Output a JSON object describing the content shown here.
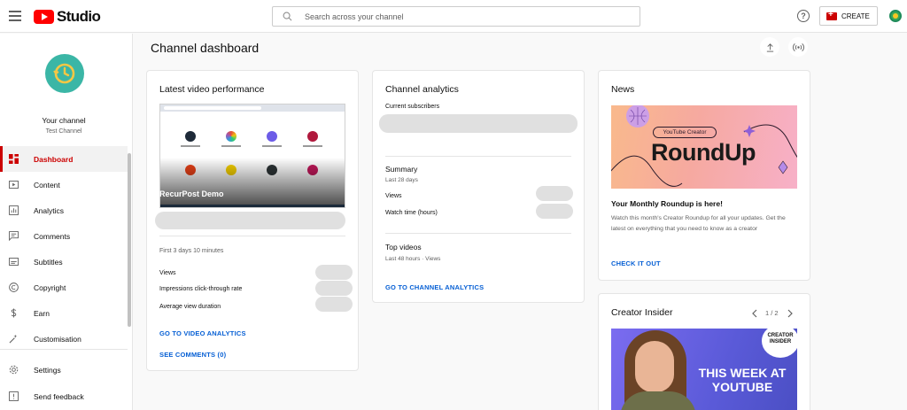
{
  "header": {
    "logo_text": "Studio",
    "search_placeholder": "Search across your channel",
    "create_label": "CREATE"
  },
  "sidebar": {
    "your_channel_label": "Your channel",
    "channel_name": "Test Channel",
    "items": [
      {
        "label": "Dashboard",
        "icon": "dashboard-icon",
        "active": true
      },
      {
        "label": "Content",
        "icon": "content-icon"
      },
      {
        "label": "Analytics",
        "icon": "analytics-icon"
      },
      {
        "label": "Comments",
        "icon": "comments-icon"
      },
      {
        "label": "Subtitles",
        "icon": "subtitles-icon"
      },
      {
        "label": "Copyright",
        "icon": "copyright-icon"
      },
      {
        "label": "Earn",
        "icon": "earn-icon"
      },
      {
        "label": "Customisation",
        "icon": "customisation-icon"
      }
    ],
    "bottom_items": [
      {
        "label": "Settings",
        "icon": "settings-icon"
      },
      {
        "label": "Send feedback",
        "icon": "feedback-icon"
      }
    ]
  },
  "main": {
    "page_title": "Channel dashboard"
  },
  "latest_video": {
    "title": "Latest video performance",
    "thumbnail_title": "RecurPost Demo",
    "period": "First 3 days 10 minutes",
    "metrics": [
      "Views",
      "Impressions click-through rate",
      "Average view duration"
    ],
    "analytics_link": "GO TO VIDEO ANALYTICS",
    "comments_link": "SEE COMMENTS (0)"
  },
  "channel_analytics": {
    "title": "Channel analytics",
    "subscribers_label": "Current subscribers",
    "summary_title": "Summary",
    "summary_period": "Last 28 days",
    "summary_metrics": [
      "Views",
      "Watch time (hours)"
    ],
    "top_videos_title": "Top videos",
    "top_videos_period": "Last 48 hours · Views",
    "link": "GO TO CHANNEL ANALYTICS"
  },
  "news": {
    "title": "News",
    "image_pill": "YouTube Creator",
    "image_headline": "RoundUp",
    "headline": "Your Monthly Roundup is here!",
    "body": "Watch this month's Creator Roundup for all your updates. Get the latest on everything that you need to know as a creator",
    "link": "CHECK IT OUT"
  },
  "creator_insider": {
    "title": "Creator Insider",
    "pager": "1 / 2",
    "badge": "CREATOR INSIDER",
    "headline": "THIS WEEK AT YOUTUBE"
  },
  "colors": {
    "brand_red": "#ff0000",
    "active_red": "#cc0000",
    "link_blue": "#065fd4"
  }
}
